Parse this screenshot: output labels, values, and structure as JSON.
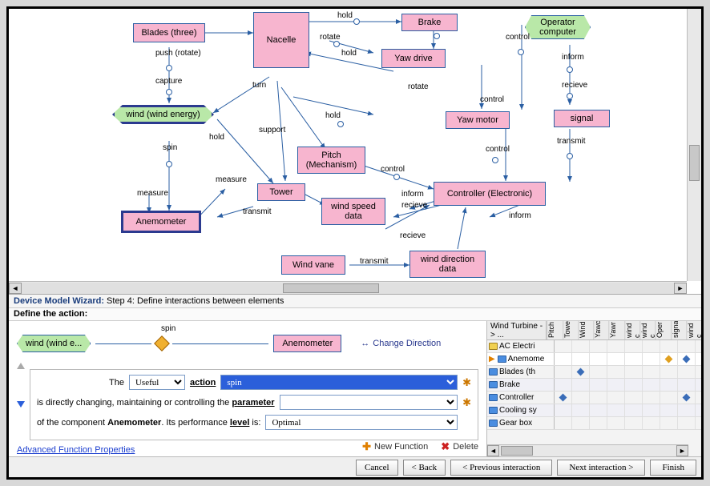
{
  "wizard": {
    "title": "Device Model Wizard:",
    "step": "Step 4: Define interactions between elements",
    "define": "Define the action:"
  },
  "diagram": {
    "nodes": {
      "blades": "Blades (three)",
      "nacelle": "Nacelle",
      "brake": "Brake",
      "operator": "Operator computer",
      "yawdrive": "Yaw drive",
      "wind": "wind (wind energy)",
      "yawmotor": "Yaw motor",
      "signal": "signal",
      "pitch": "Pitch (Mechanism)",
      "tower": "Tower",
      "controller": "Controller (Electronic)",
      "anemo": "Anemometer",
      "windspeed": "wind speed data",
      "windvane": "Wind vane",
      "winddir": "wind direction data"
    },
    "edges": {
      "push": "push (rotate)",
      "capture": "capture",
      "hold": "hold",
      "rotate": "rotate",
      "control": "control",
      "inform": "inform",
      "recieve": "recieve",
      "turn": "turn",
      "support": "support",
      "spin": "spin",
      "measure": "measure",
      "transmit": "transmit"
    }
  },
  "example": {
    "source": "wind (wind e...",
    "relation": "spin",
    "target": "Anemometer",
    "change": "Change Direction"
  },
  "form": {
    "the": "The",
    "useful": "Useful",
    "action_lbl": "action",
    "action_val": "spin",
    "line2a": "is directly changing, maintaining or controlling the ",
    "param": "parameter",
    "line3a": "of the component ",
    "comp": "Anemometer",
    "line3b": ". Its performance ",
    "level_lbl": "level",
    "line3c": " is:",
    "level_val": "Optimal",
    "adv": "Advanced Function Properties",
    "newfn": "New Function",
    "delete": "Delete"
  },
  "matrix": {
    "crumb": "Wind Turbine -> ...",
    "cols": [
      "Pitch",
      "Towe",
      "Wind",
      "Yawc",
      "Yawr",
      "wind c",
      "wind c",
      "Oper",
      "signa",
      "wind c"
    ],
    "rows": [
      {
        "ico": "y",
        "label": "AC Electri"
      },
      {
        "ico": "b",
        "label": "Anemome",
        "sel": true,
        "ptr": true
      },
      {
        "ico": "b",
        "label": "Blades (th"
      },
      {
        "ico": "b",
        "label": "Brake"
      },
      {
        "ico": "b",
        "label": "Controller"
      },
      {
        "ico": "b",
        "label": "Cooling sy"
      },
      {
        "ico": "b",
        "label": "Gear box"
      }
    ]
  },
  "buttons": {
    "cancel": "Cancel",
    "back": "< Back",
    "prev": "< Previous interaction",
    "next": "Next interaction >",
    "finish": "Finish"
  }
}
